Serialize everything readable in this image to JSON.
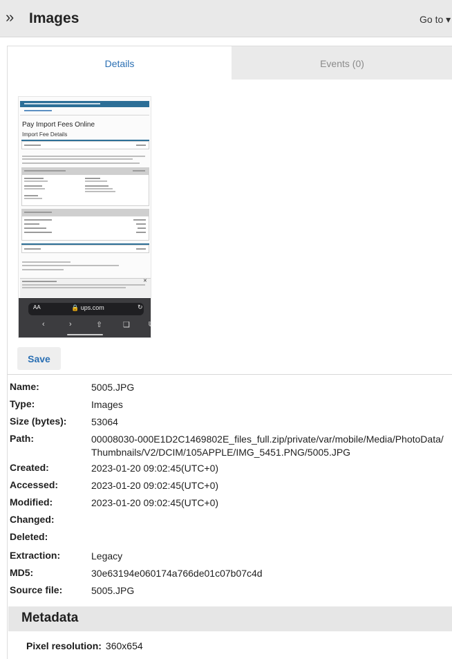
{
  "header": {
    "expand_icon": "»",
    "title": "Images",
    "goto_label": "Go to"
  },
  "tabs": {
    "details": "Details",
    "events": "Events (0)"
  },
  "thumbnail": {
    "heading": "Pay Import Fees Online",
    "subheading": "Import Fee Details",
    "browser_text_size": "AA",
    "browser_url": "ups.com",
    "reload_icon": "refresh-icon"
  },
  "save_label": "Save",
  "details": [
    {
      "label": "Name:",
      "value": "5005.JPG"
    },
    {
      "label": "Type:",
      "value": "Images"
    },
    {
      "label": "Size (bytes):",
      "value": "53064"
    },
    {
      "label": "Path:",
      "value": "00008030-000E1D2C1469802E_files_full.zip/private/var/mobile/Media/PhotoData/Thumbnails/V2/DCIM/105APPLE/IMG_5451.PNG/5005.JPG"
    },
    {
      "label": "Created:",
      "value": "2023-01-20 09:02:45(UTC+0)"
    },
    {
      "label": "Accessed:",
      "value": "2023-01-20 09:02:45(UTC+0)"
    },
    {
      "label": "Modified:",
      "value": "2023-01-20 09:02:45(UTC+0)"
    },
    {
      "label": "Changed:",
      "value": ""
    },
    {
      "label": "Deleted:",
      "value": ""
    },
    {
      "label": "Extraction:",
      "value": "Legacy"
    },
    {
      "label": "MD5:",
      "value": "30e63194e060174a766de01c07b07c4d"
    },
    {
      "label": "Source file:",
      "value": "5005.JPG"
    }
  ],
  "metadata": {
    "title": "Metadata",
    "pixel_resolution_label": "Pixel resolution:",
    "pixel_resolution_value": "360x654"
  }
}
